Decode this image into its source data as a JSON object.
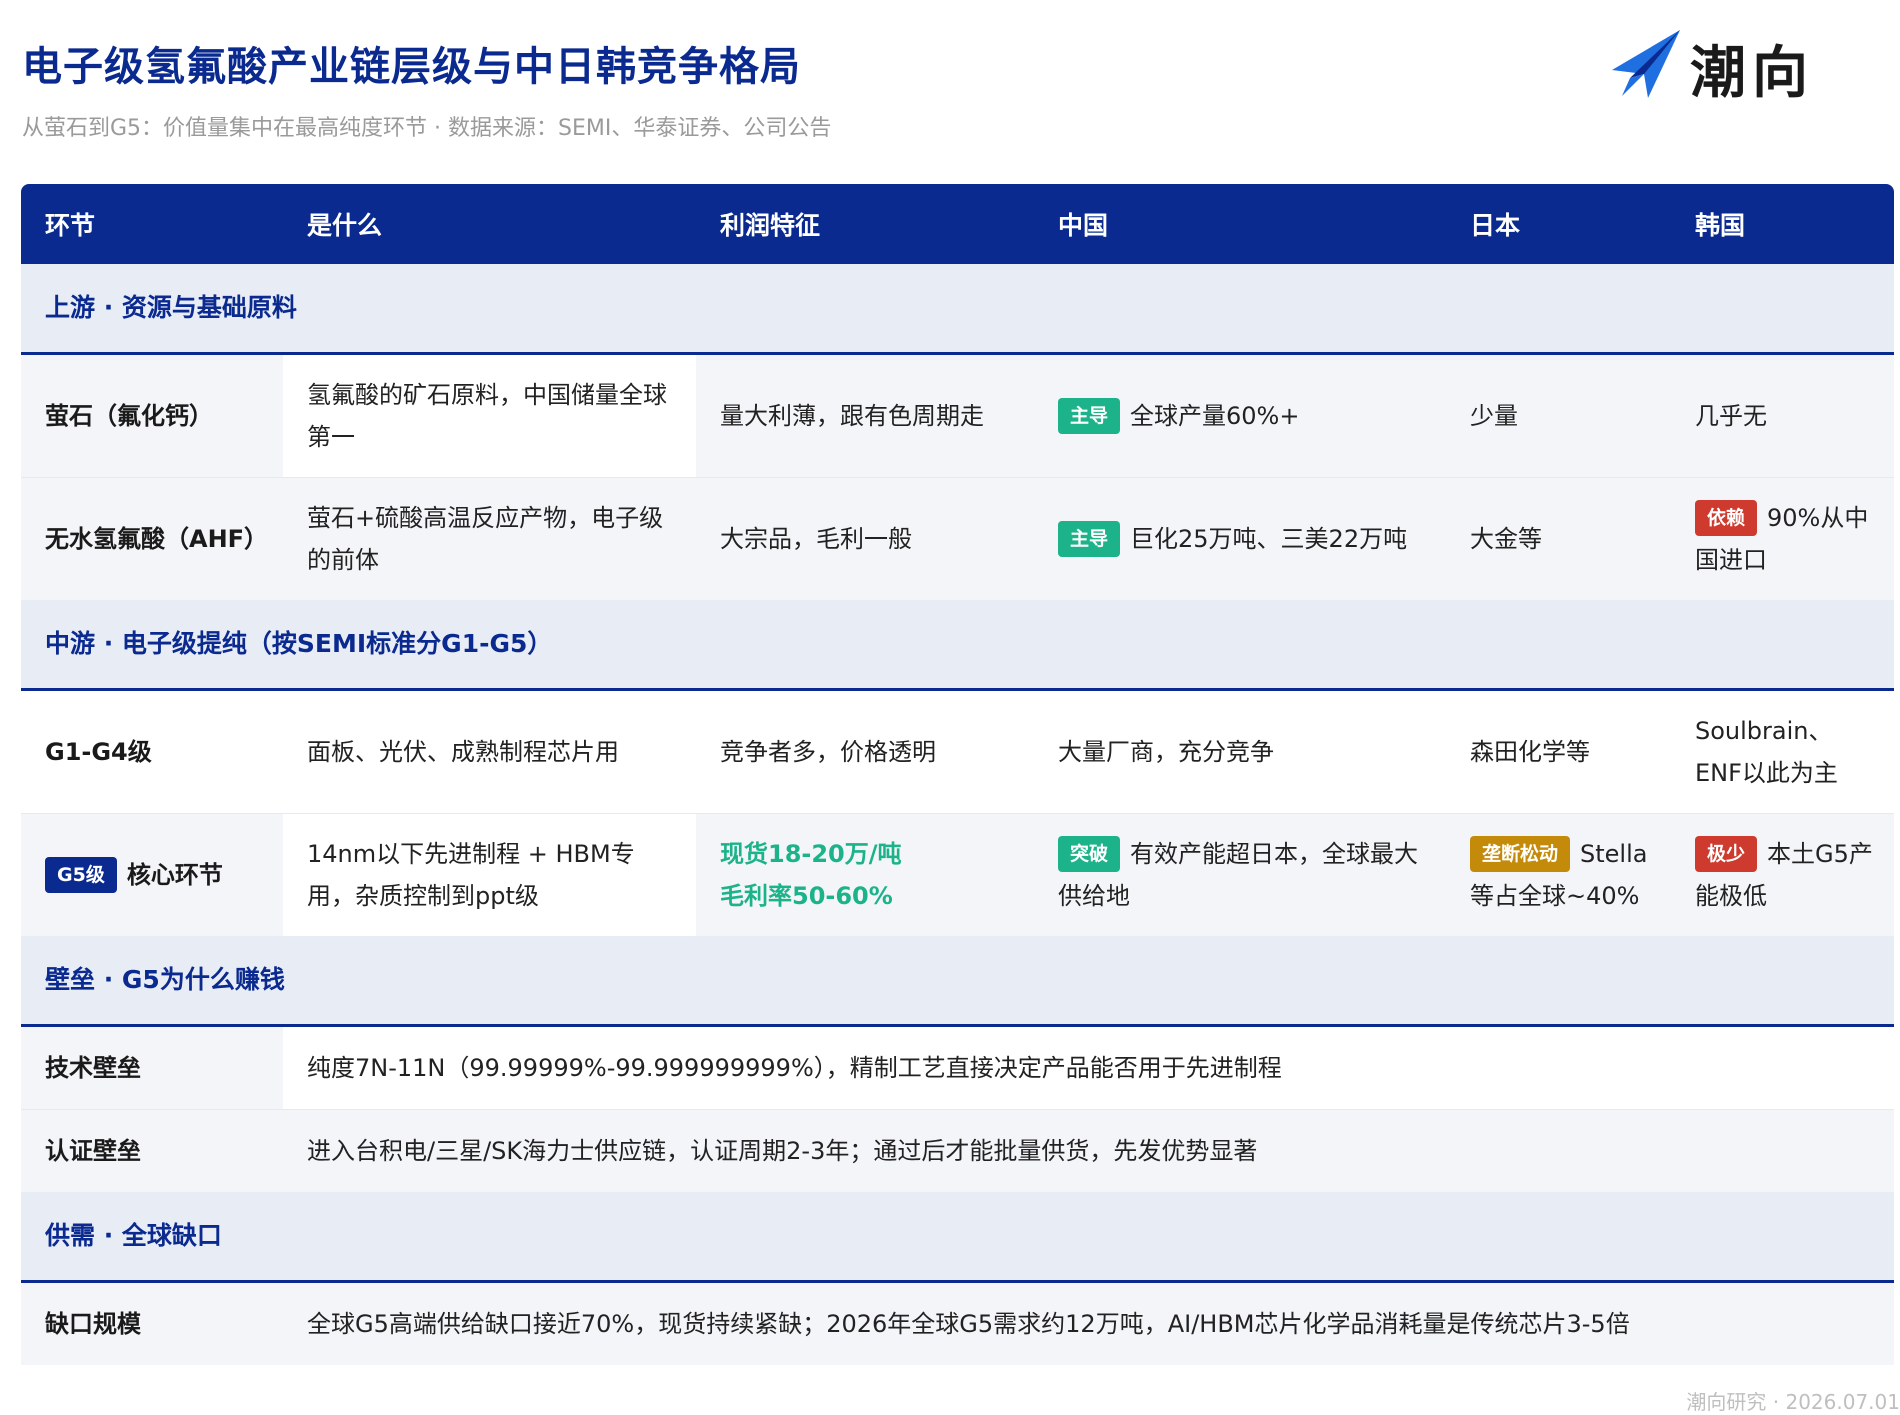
{
  "header": {
    "title": "电子级氢氟酸产业链层级与中日韩竞争格局",
    "subtitle": "从萤石到G5：价值量集中在最高纯度环节 · 数据来源：SEMI、华泰证券、公司公告",
    "logo_text": "潮向",
    "logo_icon": "paper-plane-icon",
    "brand_color": "#0a2a8f"
  },
  "table": {
    "columns": [
      "环节",
      "是什么",
      "利润特征",
      "中国",
      "日本",
      "韩国"
    ],
    "sections": [
      {
        "title": "上游 · 资源与基础原料",
        "rows": [
          {
            "name": "萤石（氟化钙）",
            "what": "氢氟酸的矿石原料，中国储量全球第一",
            "profit": "量大利薄，跟有色周期走",
            "china": {
              "badge": "主导",
              "text": "全球产量60%+"
            },
            "japan": {
              "text": "少量"
            },
            "korea": {
              "text": "几乎无"
            }
          },
          {
            "name": "无水氢氟酸（AHF）",
            "what": "萤石+硫酸高温反应产物，电子级的前体",
            "profit": "大宗品，毛利一般",
            "china": {
              "badge": "主导",
              "text": "巨化25万吨、三美22万吨"
            },
            "japan": {
              "text": "大金等"
            },
            "korea": {
              "badge": "依赖",
              "text": "90%从中国进口"
            }
          }
        ]
      },
      {
        "title": "中游 · 电子级提纯（按SEMI标准分G1-G5）",
        "rows": [
          {
            "name": "G1-G4级",
            "what": "面板、光伏、成熟制程芯片用",
            "profit": "竞争者多，价格透明",
            "china": {
              "text": "大量厂商，充分竞争"
            },
            "japan": {
              "text": "森田化学等"
            },
            "korea": {
              "text": "Soulbrain、ENF以此为主"
            }
          },
          {
            "name_badge": "G5级",
            "name": "核心环节",
            "what": "14nm以下先进制程 + HBM专用，杂质控制到ppt级",
            "profit_line1": "现货18-20万/吨",
            "profit_line2": "毛利率50-60%",
            "china": {
              "badge": "突破",
              "text": "有效产能超日本，全球最大供给地"
            },
            "japan": {
              "badge": "垄断松动",
              "text": "Stella等占全球~40%"
            },
            "korea": {
              "badge": "极少",
              "text": "本土G5产能极低"
            }
          }
        ]
      },
      {
        "title": "壁垒 · G5为什么赚钱",
        "rows": [
          {
            "name": "技术壁垒",
            "text": "纯度7N-11N（99.99999%-99.999999999%），精制工艺直接决定产品能否用于先进制程"
          },
          {
            "name": "认证壁垒",
            "text": "进入台积电/三星/SK海力士供应链，认证周期2-3年；通过后才能批量供货，先发优势显著"
          }
        ]
      },
      {
        "title": "供需 · 全球缺口",
        "rows": [
          {
            "name": "缺口规模",
            "text": "全球G5高端供给缺口接近70%，现货持续紧缺；2026年全球G5需求约12万吨，AI/HBM芯片化学品消耗量是传统芯片3-5倍"
          }
        ]
      }
    ]
  },
  "footer": {
    "text": "潮向研究 · 2026.07.01"
  },
  "colors": {
    "dominant_badge": "#1cb38a",
    "dependent_badge": "#cf3a2e",
    "loosening_badge": "#c48a0a",
    "highlight_text": "#1cb38a"
  }
}
